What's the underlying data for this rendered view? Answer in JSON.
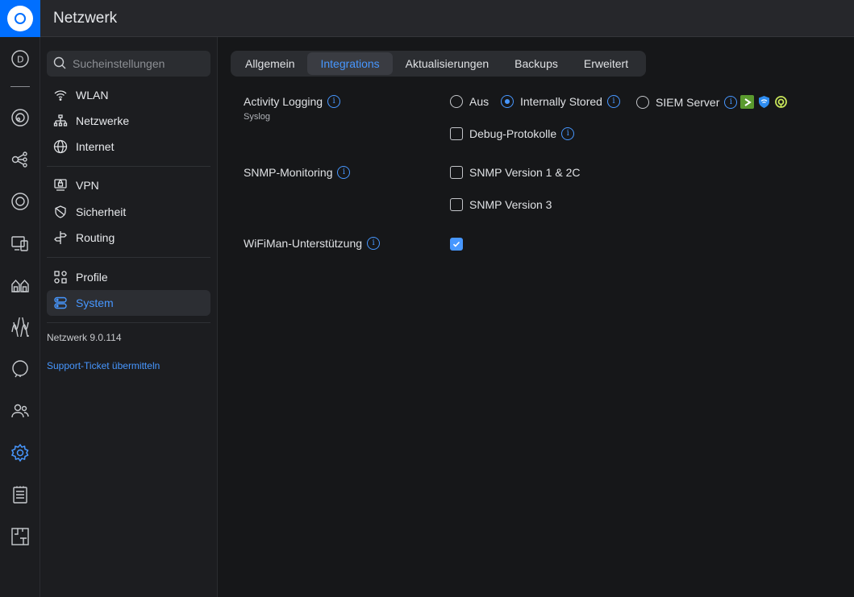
{
  "header": {
    "title": "Netzwerk"
  },
  "rail": {
    "icons": [
      "unifi-logo-icon",
      "dashboard-icon",
      "topology-icon",
      "devices-icon",
      "client-devices-icon",
      "ports-icon",
      "radios-icon",
      "insights-icon",
      "users-icon",
      "settings-icon",
      "logs-icon",
      "floorplan-icon"
    ]
  },
  "sidebar": {
    "search_placeholder": "Sucheinstellungen",
    "items": [
      {
        "label": "WLAN",
        "icon": "wifi-icon"
      },
      {
        "label": "Netzwerke",
        "icon": "networks-icon"
      },
      {
        "label": "Internet",
        "icon": "globe-icon"
      },
      {
        "label": "VPN",
        "icon": "vpn-icon"
      },
      {
        "label": "Sicherheit",
        "icon": "shield-icon"
      },
      {
        "label": "Routing",
        "icon": "routing-icon"
      },
      {
        "label": "Profile",
        "icon": "profiles-icon"
      },
      {
        "label": "System",
        "icon": "system-icon",
        "active": true
      }
    ],
    "version": "Netzwerk 9.0.114",
    "support_link": "Support-Ticket übermitteln"
  },
  "tabs": [
    {
      "label": "Allgemein"
    },
    {
      "label": "Integrations",
      "active": true
    },
    {
      "label": "Aktualisierungen"
    },
    {
      "label": "Backups"
    },
    {
      "label": "Erweitert"
    }
  ],
  "settings": {
    "activity_logging": {
      "label": "Activity Logging",
      "sublabel": "Syslog",
      "options": [
        "Aus",
        "Internally Stored",
        "SIEM Server"
      ],
      "selected": "Internally Stored",
      "debug_label": "Debug-Protokolle",
      "debug_checked": false
    },
    "snmp": {
      "label": "SNMP-Monitoring",
      "v1_label": "SNMP Version 1 & 2C",
      "v1_checked": false,
      "v3_label": "SNMP Version 3",
      "v3_checked": false
    },
    "wifiman": {
      "label": "WiFiMan-Unterstützung",
      "checked": true
    }
  },
  "colors": {
    "accent": "#4797ff",
    "brand": "#006fff",
    "background": "#161719",
    "panel": "#1c1d20"
  }
}
